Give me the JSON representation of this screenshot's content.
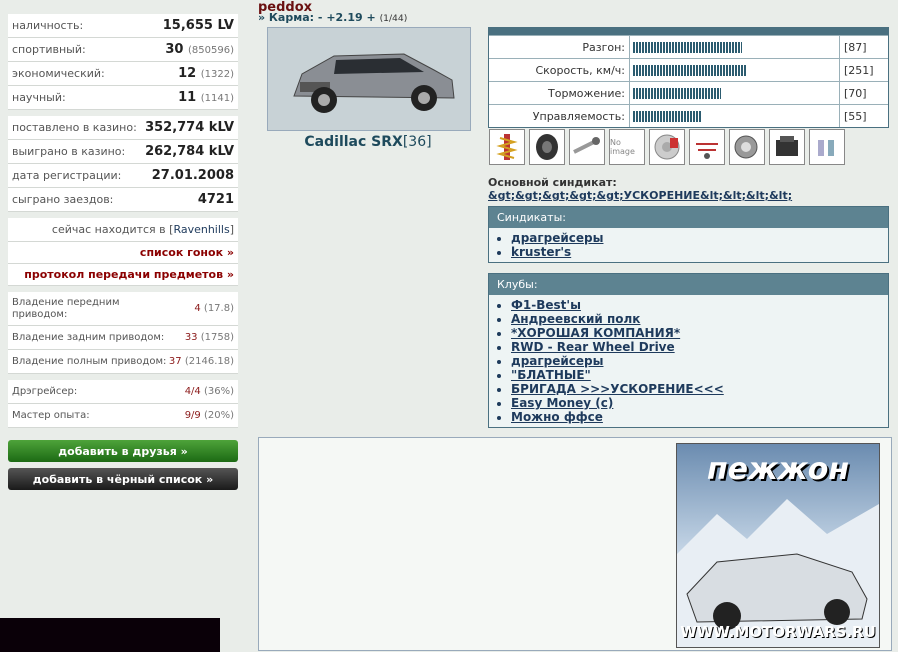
{
  "profile": {
    "name_fragment": "peddox",
    "karma_label": "» Карма:",
    "karma_minus": "-",
    "karma_value": "+2.19",
    "karma_plus": "+",
    "karma_count": "(1/44)"
  },
  "left_stats": [
    {
      "label": "наличность:",
      "value": "15,655 LV",
      "extra": ""
    },
    {
      "label": "спортивный:",
      "value": "30",
      "extra": "(850596)"
    },
    {
      "label": "экономический:",
      "value": "12",
      "extra": "(1322)"
    },
    {
      "label": "научный:",
      "value": "11",
      "extra": "(1141)"
    }
  ],
  "left_stats2": [
    {
      "label": "поставлено в казино:",
      "value": "352,774 kLV"
    },
    {
      "label": "выиграно в казино:",
      "value": "262,784 kLV"
    },
    {
      "label": "дата регистрации:",
      "value": "27.01.2008"
    },
    {
      "label": "сыграно заездов:",
      "value": "4721"
    }
  ],
  "location": {
    "label": "сейчас находится в [",
    "city": "Ravenhills",
    "end": "]"
  },
  "links": {
    "races": "список гонок »",
    "protocol": "протокол передачи предметов »"
  },
  "drive": [
    {
      "label": "Владение передним приводом:",
      "value": "4",
      "extra": "(17.8)"
    },
    {
      "label": "Владение задним приводом:",
      "value": "33",
      "extra": "(1758)"
    },
    {
      "label": "Владение полным приводом:",
      "value": "37",
      "extra": "(2146.18)"
    }
  ],
  "skills": [
    {
      "label": "Дрэгрейсер:",
      "value": "4/4",
      "extra": "(36%)"
    },
    {
      "label": "Мастер опыта:",
      "value": "9/9",
      "extra": "(20%)"
    }
  ],
  "buttons": {
    "add_friend": "добавить в друзья »",
    "add_black": "добавить в чёрный список »"
  },
  "car": {
    "name": "Cadillac SRX",
    "level": "[36]"
  },
  "car_stats": [
    {
      "label": "Разгон:",
      "value": "[87]",
      "level": 0.87
    },
    {
      "label": "Скорость, км/ч:",
      "value": "[251]",
      "level": 0.9
    },
    {
      "label": "Торможение:",
      "value": "[70]",
      "level": 0.7
    },
    {
      "label": "Управляемость:",
      "value": "[55]",
      "level": 0.55
    }
  ],
  "parts": [
    "suspension-icon",
    "tire-icon",
    "exhaust-icon",
    "no-image-icon",
    "brake-icon",
    "wiring-icon",
    "turbo-icon",
    "engine-icon",
    "injector-icon"
  ],
  "no_image_text": "No image",
  "syndicate": {
    "label": "Основной синдикат:",
    "name": "&gt;&gt;&gt;&gt;&gt;УСКОРЕНИЕ&lt;&lt;&lt;&lt;"
  },
  "syndicates": {
    "title": "Синдикаты:",
    "items": [
      "драгрейсеры",
      "kruster's"
    ]
  },
  "clubs": {
    "title": "Клубы:",
    "items": [
      "Ф1-Best'ы",
      "Андреевский полк",
      "*ХОРОШАЯ КОМПАНИЯ*",
      "RWD - Rear Wheel Drive",
      "драгрейсеры",
      "\"БЛАТНЫЕ\"",
      "БРИГАДА >>>УСКОРЕНИЕ<<<",
      "Easy Money (с)",
      "Можно ффсе"
    ]
  },
  "ad": {
    "title": "пежжон",
    "url": "WWW.MOTORWARS.RU"
  }
}
